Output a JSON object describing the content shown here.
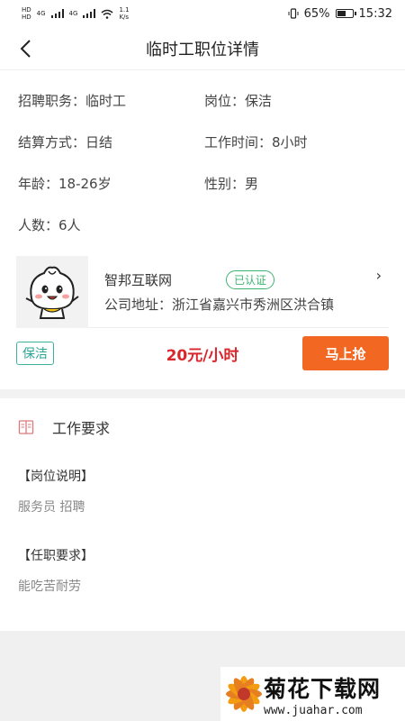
{
  "status_bar": {
    "net_left_a": "HD",
    "net_left_b": "HD",
    "signal_a": "4G",
    "signal_b": "4G",
    "speed": "1.1",
    "speed_unit": "K/s",
    "battery_pct": "65%",
    "battery_level": 0.65,
    "time": "15:32"
  },
  "header": {
    "title": "临时工职位详情"
  },
  "info": {
    "position_label": "招聘职务：",
    "position_value": "临时工",
    "job_label": "岗位：",
    "job_value": "保洁",
    "settle_label": "结算方式：",
    "settle_value": "日结",
    "hours_label": "工作时间：",
    "hours_value": "8小时",
    "age_label": "年龄：",
    "age_value": "18-26岁",
    "gender_label": "性别：",
    "gender_value": "男",
    "count_label": "人数：",
    "count_value": "6人"
  },
  "company": {
    "name": "智邦互联网",
    "verified": "已认证",
    "address_label": "公司地址：",
    "address_value": "浙江省嘉兴市秀洲区洪合镇"
  },
  "action": {
    "tag": "保洁",
    "salary": "20元/小时",
    "grab_label": "马上抢"
  },
  "requirements": {
    "section_title": "工作要求",
    "desc_title": "【岗位说明】",
    "desc_text": "服务员 招聘",
    "req_title": "【任职要求】",
    "req_text": "能吃苦耐劳"
  },
  "watermark": {
    "title": "菊花下载网",
    "url": "www.juahar.com"
  },
  "colors": {
    "accent_orange": "#f26722",
    "salary_red": "#d9262c",
    "tag_green": "#2aa596",
    "verified_green": "#3cb371"
  }
}
